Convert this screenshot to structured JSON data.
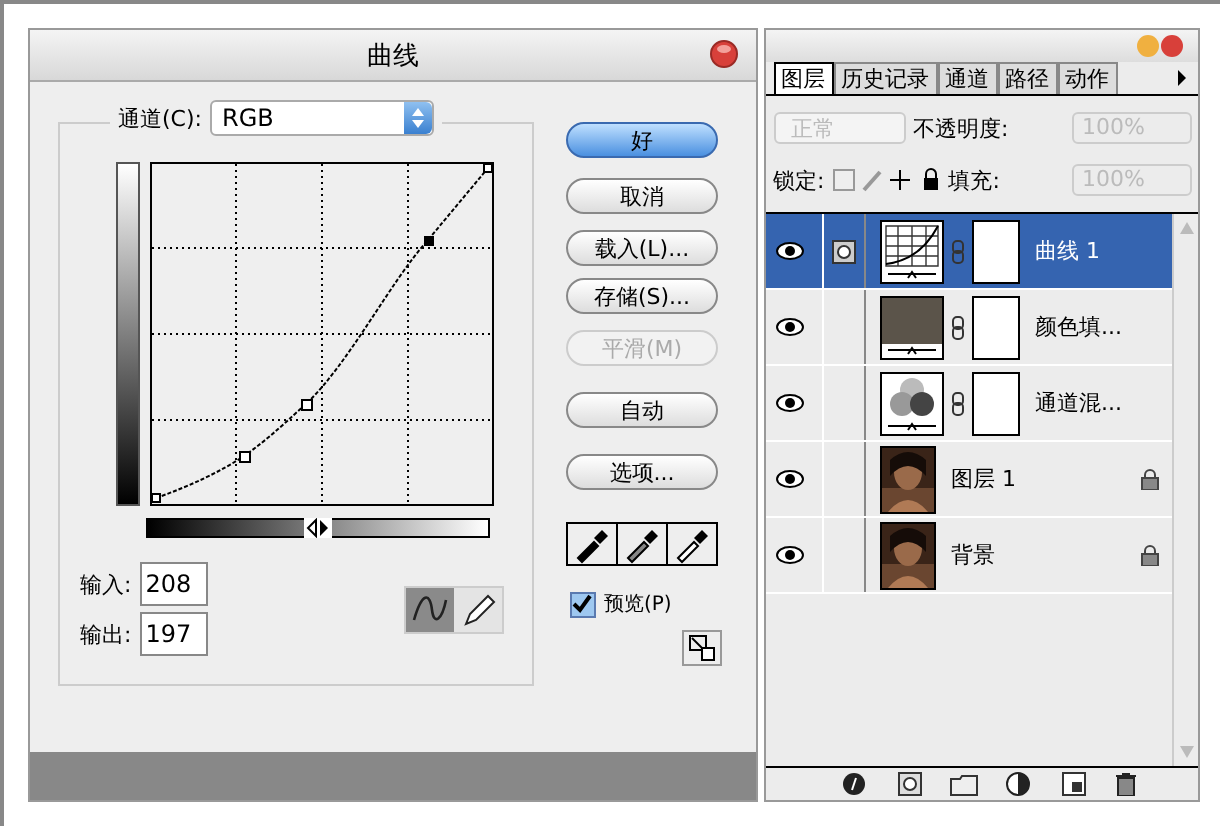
{
  "curves_dialog": {
    "title": "曲线",
    "channel_label": "通道(C):",
    "channel_value": "RGB",
    "buttons": [
      {
        "label": "好",
        "kind": "default",
        "disabled": false
      },
      {
        "label": "取消",
        "kind": "normal",
        "disabled": false
      },
      {
        "label": "载入(L)...",
        "kind": "normal",
        "disabled": false
      },
      {
        "label": "存储(S)...",
        "kind": "normal",
        "disabled": false
      },
      {
        "label": "平滑(M)",
        "kind": "normal",
        "disabled": true
      },
      {
        "label": "自动",
        "kind": "normal",
        "disabled": false
      },
      {
        "label": "选项...",
        "kind": "normal",
        "disabled": false
      }
    ],
    "input_label": "输入:",
    "input_value": "208",
    "output_label": "输出:",
    "output_value": "197",
    "tools": [
      {
        "kind": "curve",
        "selected": true
      },
      {
        "kind": "pencil",
        "selected": false
      }
    ],
    "preview": {
      "label": "预览(P)",
      "checked": true
    }
  },
  "layers_panel": {
    "tabs": [
      {
        "label": "图层",
        "selected": true
      },
      {
        "label": "历史记录",
        "selected": false
      },
      {
        "label": "通道",
        "selected": false
      },
      {
        "label": "路径",
        "selected": false
      },
      {
        "label": "动作",
        "selected": false
      }
    ],
    "blend_mode": "正常",
    "opacity_label": "不透明度:",
    "opacity_value": "100%",
    "lock_label": "锁定:",
    "fill_label": "填充:",
    "fill_value": "100%",
    "layers": [
      {
        "name": "曲线 1",
        "kind": "curves",
        "selected": true,
        "visible": true,
        "locked": false
      },
      {
        "name": "颜色填...",
        "kind": "fill",
        "selected": false,
        "visible": true,
        "locked": false
      },
      {
        "name": "通道混...",
        "kind": "mixer",
        "selected": false,
        "visible": true,
        "locked": false
      },
      {
        "name": "图层 1",
        "selected": false,
        "visible": true,
        "locked": true
      },
      {
        "name": "背景",
        "selected": false,
        "visible": true,
        "locked": true
      }
    ]
  }
}
